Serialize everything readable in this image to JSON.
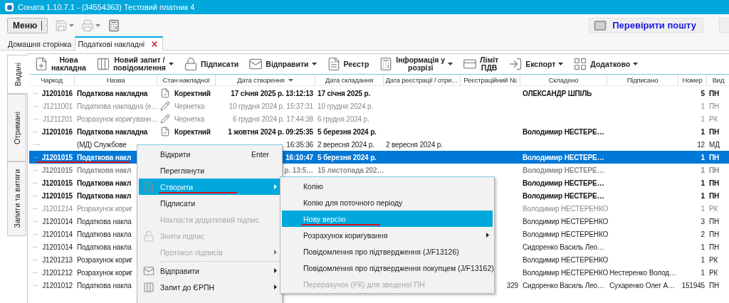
{
  "window": {
    "title": "Соната 1.10.7.1 - (34554363) Тестовий платник 4"
  },
  "top_toolbar": {
    "menu_button": "Меню",
    "mail_button": "Перевірити пошту"
  },
  "tabs": [
    {
      "label": "Домашня сторінка",
      "selected": false,
      "closable": false
    },
    {
      "label": "Податкові накладні",
      "selected": true,
      "closable": true
    }
  ],
  "side_tabs": [
    {
      "label": "Видані",
      "selected": true
    },
    {
      "label": "Отримані",
      "selected": false
    },
    {
      "label": "Запити та витяги",
      "selected": false
    }
  ],
  "toolbar": [
    {
      "label": "Нова\nнакладна",
      "dropdown": false
    },
    {
      "label": "Новий запит /\nповідомлення",
      "dropdown": true
    },
    {
      "label": "Підписати",
      "dropdown": false
    },
    {
      "label": "Відправити",
      "dropdown": true
    },
    {
      "label": "Реєстр",
      "dropdown": false
    },
    {
      "label": "Інформація у\nрозрізі",
      "dropdown": true
    },
    {
      "label": "Ліміт\nПДВ",
      "dropdown": false
    },
    {
      "label": "Експорт",
      "dropdown": true
    },
    {
      "label": "Додатково",
      "dropdown": true
    }
  ],
  "columns": [
    {
      "label": "Чаркод",
      "sorted": false
    },
    {
      "label": "Назва",
      "sorted": false
    },
    {
      "label": "Стан накладної",
      "sorted": false
    },
    {
      "label": "Дата створення",
      "sorted": true
    },
    {
      "label": "Дата складання",
      "sorted": false
    },
    {
      "label": "Дата реєстрації / отри…",
      "sorted": false
    },
    {
      "label": "Реєстраційний №",
      "sorted": false
    },
    {
      "label": "Складено",
      "sorted": false
    },
    {
      "label": "Підписано",
      "sorted": false
    },
    {
      "label": "Номер",
      "sorted": false
    },
    {
      "label": "Вид",
      "sorted": false
    }
  ],
  "rows": [
    {
      "kind": "bold",
      "selected": false,
      "marked": false,
      "cells": [
        "J1201016",
        "Податкова накладна",
        "Коректний",
        "17 січня 2025 р. 13:12:13",
        "17 січня 2025 р.",
        null,
        null,
        "ОЛЕКСАНДР ШПІЛЬ",
        null,
        "5",
        "ПН"
      ]
    },
    {
      "kind": "faded",
      "selected": false,
      "marked": false,
      "cells": [
        "J1211001",
        "Податкова накладна (е…",
        "Чернетка",
        "10 грудня 2024 р. 15:37:31",
        "10 грудня 2024 р.",
        null,
        null,
        null,
        null,
        "1",
        "ПН"
      ]
    },
    {
      "kind": "faded",
      "selected": false,
      "marked": false,
      "cells": [
        "J1211201",
        "Розрахунок коригуванн…",
        "Чернетка",
        "6 грудня 2024 р. 17:44:38",
        "6 грудня 2024 р.",
        null,
        null,
        null,
        null,
        "1",
        "РК"
      ]
    },
    {
      "kind": "bold",
      "selected": false,
      "marked": false,
      "cells": [
        "J1201016",
        "Податкова накладна",
        "Коректний",
        "1 жовтня 2024 р. 09:25:35",
        "5 березня 2024 р.",
        null,
        null,
        "Володимир НЕСТЕРЕ…",
        null,
        "1",
        "ПН"
      ]
    },
    {
      "kind": "plain",
      "selected": false,
      "marked": false,
      "cells": [
        null,
        "(МД) Службове",
        null,
        "16:35:36",
        "2 вересня 2024 р.",
        "2 вересня 2024 р.",
        null,
        null,
        null,
        "12",
        "МД"
      ]
    },
    {
      "kind": "bold",
      "selected": true,
      "marked": true,
      "cells": [
        "J1201015",
        "Податкова накл",
        null,
        "16:10:47",
        "5 березня 2024 р.",
        null,
        null,
        "Володимир НЕСТЕРЕ…",
        null,
        "1",
        "ПН"
      ]
    },
    {
      "kind": "faded-bold",
      "selected": false,
      "marked": false,
      "cells": [
        "J1201015",
        "Податкова накл",
        null,
        "р. 13:5…",
        "15 листопада 202…",
        null,
        null,
        "Володимир НЕСТЕРЕ…",
        null,
        "1",
        "ПН"
      ]
    },
    {
      "kind": "bold",
      "selected": false,
      "marked": false,
      "cells": [
        "J1201015",
        "Податкова накл",
        null,
        null,
        null,
        null,
        null,
        "Володимир НЕСТЕРЕ…",
        null,
        "1",
        "ПН"
      ]
    },
    {
      "kind": "bold",
      "selected": false,
      "marked": false,
      "cells": [
        "J1201015",
        "Податкова накл",
        null,
        null,
        null,
        null,
        null,
        "Володимир НЕСТЕРЕ…",
        null,
        "1",
        "ПН"
      ]
    },
    {
      "kind": "faded",
      "selected": false,
      "marked": false,
      "cells": [
        "J1201214",
        "Розрахунок кориг",
        null,
        null,
        null,
        null,
        null,
        "Володимир НЕСТЕРЕНКО",
        null,
        "1",
        "РК"
      ]
    },
    {
      "kind": "plain",
      "selected": false,
      "marked": false,
      "cells": [
        "J1201014",
        "Податкова накла",
        null,
        null,
        null,
        null,
        null,
        "Володимир НЕСТЕРЕНКО",
        null,
        "3",
        "ПН"
      ]
    },
    {
      "kind": "plain",
      "selected": false,
      "marked": false,
      "cells": [
        "J1201014",
        "Податкова накла",
        null,
        null,
        null,
        null,
        null,
        "Володимир НЕСТЕРЕНКО",
        null,
        "2",
        "ПН"
      ]
    },
    {
      "kind": "plain",
      "selected": false,
      "marked": false,
      "cells": [
        "J1201014",
        "Податкова накла",
        null,
        null,
        null,
        null,
        null,
        "Сидоренко Василь Лео…",
        null,
        "1",
        "ПН"
      ]
    },
    {
      "kind": "plain",
      "selected": false,
      "marked": false,
      "cells": [
        "J1201213",
        "Розрахунок кориг",
        null,
        null,
        null,
        null,
        null,
        "Володимир НЕСТЕРЕНКО",
        null,
        "1",
        "РК"
      ]
    },
    {
      "kind": "plain",
      "selected": false,
      "marked": false,
      "cells": [
        "J1201212",
        "Розрахунок кориг",
        null,
        null,
        null,
        null,
        null,
        "Володимир НЕСТЕРЕНКО",
        "Нестеренко Волод…",
        "1",
        "РК"
      ]
    },
    {
      "kind": "plain",
      "selected": false,
      "marked": false,
      "cells": [
        "J1201012",
        "Податкова накла",
        null,
        null,
        null,
        null,
        "329",
        "Сидоренко Василь Лео…",
        "Сухаренко Олег А…",
        "151945",
        "ПН"
      ]
    }
  ],
  "context_menu": {
    "items": [
      {
        "label": "Відкрити",
        "shortcut": "Enter",
        "disabled": false,
        "highlighted": false,
        "marked": false,
        "submenu": false
      },
      {
        "label": "Переглянути",
        "disabled": false,
        "highlighted": false,
        "marked": false,
        "submenu": false
      },
      {
        "label": "Створити",
        "disabled": false,
        "highlighted": true,
        "marked": true,
        "submenu": true
      },
      {
        "label": "Підписати",
        "disabled": false,
        "highlighted": false,
        "marked": false,
        "submenu": false
      },
      {
        "label": "Накласти додатковий підпис",
        "disabled": true,
        "highlighted": false,
        "marked": false,
        "submenu": false
      },
      {
        "label": "Зняти підпис",
        "disabled": true,
        "highlighted": false,
        "marked": false,
        "submenu": false
      },
      {
        "label": "Протокол підписів",
        "disabled": true,
        "highlighted": false,
        "marked": false,
        "submenu": true
      },
      {
        "label": "Відправити",
        "disabled": false,
        "highlighted": false,
        "marked": false,
        "submenu": true
      },
      {
        "label": "Запит до ЄРПН",
        "disabled": false,
        "highlighted": false,
        "marked": false,
        "submenu": true
      }
    ]
  },
  "submenu": {
    "items": [
      {
        "label": "Копію",
        "disabled": false,
        "highlighted": false,
        "marked": false,
        "submenu": false
      },
      {
        "label": "Копію для поточного періоду",
        "disabled": false,
        "highlighted": false,
        "marked": false,
        "submenu": false
      },
      {
        "label": "Нову версію",
        "disabled": false,
        "highlighted": true,
        "marked": true,
        "submenu": false
      },
      {
        "label": "Розрахунок коригування",
        "disabled": false,
        "highlighted": false,
        "marked": false,
        "submenu": true
      },
      {
        "label": "Повідомлення про підтвердження (J/F13126)",
        "disabled": false,
        "highlighted": false,
        "marked": false,
        "submenu": false
      },
      {
        "label": "Повідомлення про підтвердження покупцем (J/F13162)",
        "disabled": false,
        "highlighted": false,
        "marked": false,
        "submenu": false
      },
      {
        "label": "Перерахунок (РК) для зведеної ПН",
        "disabled": true,
        "highlighted": false,
        "marked": false,
        "submenu": false
      }
    ]
  }
}
